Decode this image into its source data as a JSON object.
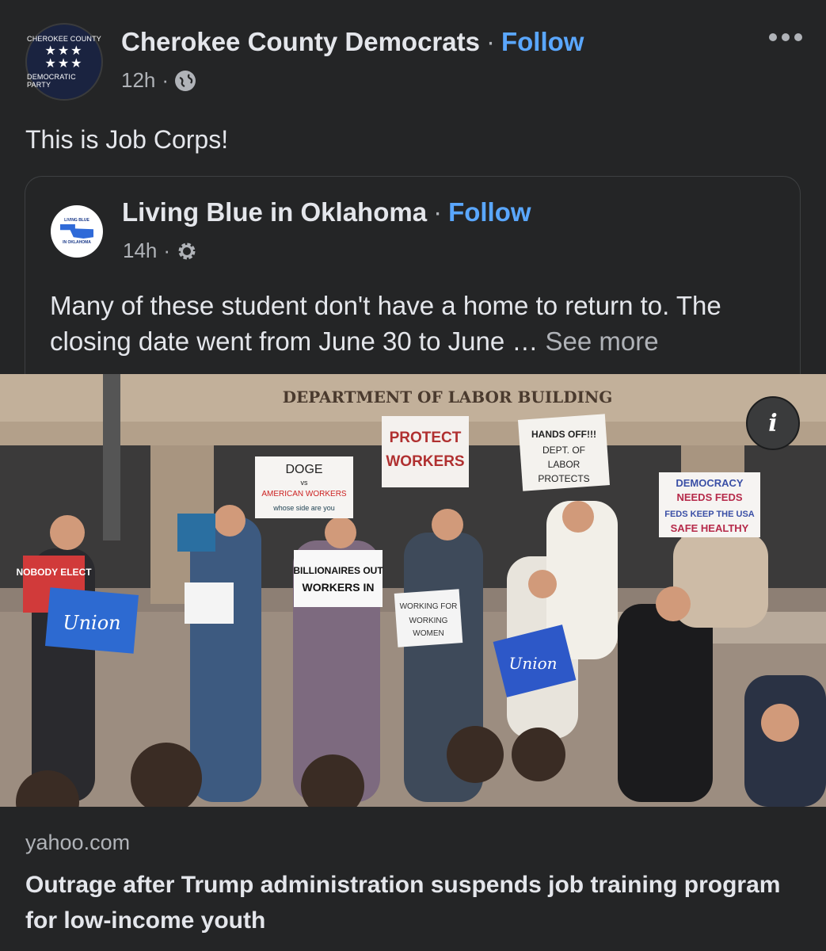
{
  "post": {
    "page_name": "Cherokee County Democrats",
    "follow_label": "Follow",
    "time": "12h",
    "separator": "·",
    "caption": "This is Job Corps!",
    "avatar_top": "CHEROKEE COUNTY",
    "avatar_bottom": "DEMOCRATIC PARTY",
    "privacy_icon": "globe-icon",
    "more_icon": "more-options-icon"
  },
  "shared_post": {
    "page_name": "Living Blue in Oklahoma",
    "follow_label": "Follow",
    "time": "14h",
    "separator": "·",
    "privacy_icon": "gear-icon",
    "avatar_top": "LIVING BLUE",
    "avatar_bottom": "IN OKLAHOMA",
    "text": "Many of these student don't have a home to return to. The closing date went from June 30 to June … ",
    "see_more": "See more"
  },
  "photo": {
    "building_sign": "DEPARTMENT OF LABOR BUILDING",
    "signs": {
      "protect": "PROTECT WORKERS",
      "doge_1": "DOGE",
      "doge_2": "vs",
      "doge_3": "AMERICAN WORKERS",
      "doge_4": "whose side are you",
      "hands_off": "HANDS OFF!!! DEPT. OF LABOR PROTECTS",
      "democracy_1": "DEMOCRACY",
      "democracy_2": "NEEDS FEDS",
      "democracy_3": "FEDS KEEP THE USA",
      "democracy_4": "SAFE HEALTHY",
      "billionaires_1": "BILLIONAIRES OUT",
      "billionaires_2": "WORKERS IN",
      "working_women": "WORKING FOR WORKING WOMEN",
      "union": "Union",
      "nobody": "NOBODY ELECT"
    },
    "info_icon": "info-icon",
    "info_glyph": "i"
  },
  "link": {
    "domain": "yahoo.com",
    "title": "Outrage after Trump administration suspends job training program for low-income youth"
  },
  "colors": {
    "background": "#242526",
    "accent": "#5aa7ff",
    "secondary_text": "#b0b3b8"
  }
}
